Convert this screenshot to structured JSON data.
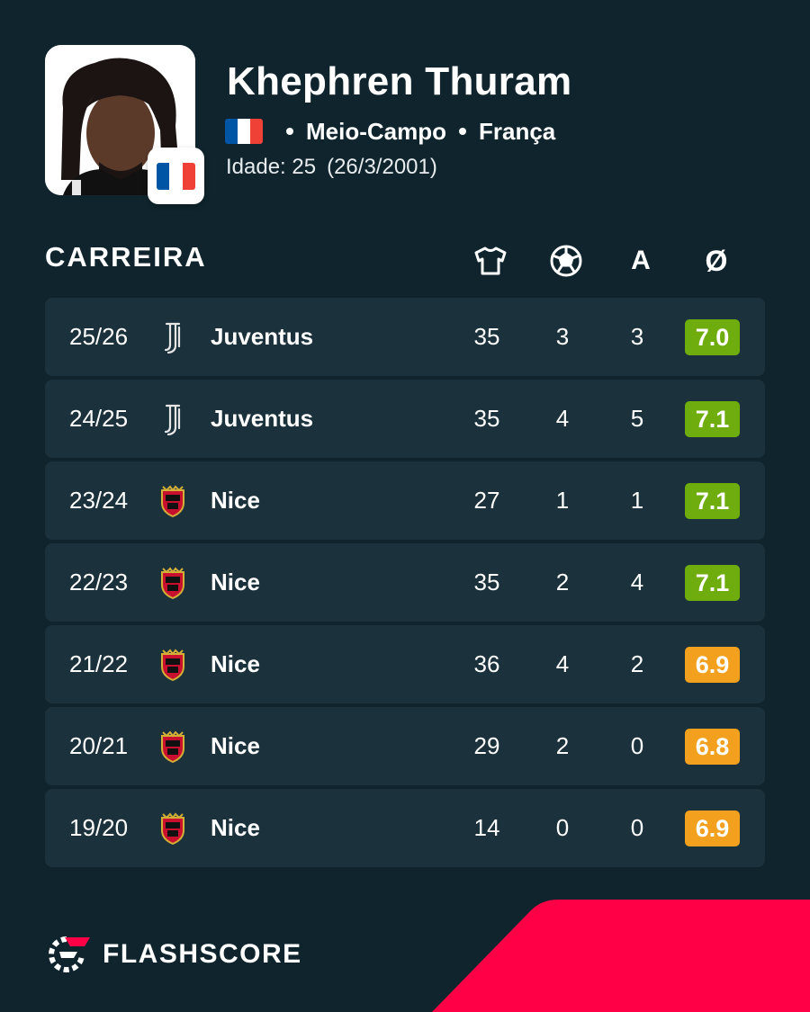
{
  "player": {
    "name": "Khephren Thuram",
    "position": "Meio-Campo",
    "country": "França",
    "age_text": "Idade: 25",
    "birthdate_text": "(26/3/2001)",
    "flag_colors": [
      "#0055a4",
      "#ffffff",
      "#ef4135"
    ]
  },
  "career": {
    "title": "CARREIRA",
    "columns": {
      "apps_icon": "jersey-icon",
      "goals_icon": "football-icon",
      "assists_label": "A",
      "average_label": "Ø"
    },
    "rows": [
      {
        "season": "25/26",
        "club": "Juventus",
        "club_icon": "juventus-logo-icon",
        "apps": "35",
        "goals": "3",
        "assists": "3",
        "rating": "7.0",
        "rating_color": "#6ead0d"
      },
      {
        "season": "24/25",
        "club": "Juventus",
        "club_icon": "juventus-logo-icon",
        "apps": "35",
        "goals": "4",
        "assists": "5",
        "rating": "7.1",
        "rating_color": "#6ead0d"
      },
      {
        "season": "23/24",
        "club": "Nice",
        "club_icon": "nice-crest-icon",
        "apps": "27",
        "goals": "1",
        "assists": "1",
        "rating": "7.1",
        "rating_color": "#6ead0d"
      },
      {
        "season": "22/23",
        "club": "Nice",
        "club_icon": "nice-crest-icon",
        "apps": "35",
        "goals": "2",
        "assists": "4",
        "rating": "7.1",
        "rating_color": "#6ead0d"
      },
      {
        "season": "21/22",
        "club": "Nice",
        "club_icon": "nice-crest-icon",
        "apps": "36",
        "goals": "4",
        "assists": "2",
        "rating": "6.9",
        "rating_color": "#f2a01e"
      },
      {
        "season": "20/21",
        "club": "Nice",
        "club_icon": "nice-crest-icon",
        "apps": "29",
        "goals": "2",
        "assists": "0",
        "rating": "6.8",
        "rating_color": "#f2a01e"
      },
      {
        "season": "19/20",
        "club": "Nice",
        "club_icon": "nice-crest-icon",
        "apps": "14",
        "goals": "0",
        "assists": "0",
        "rating": "6.9",
        "rating_color": "#f2a01e"
      }
    ]
  },
  "brand": {
    "name": "FLASHSCORE",
    "accent_color": "#ff0046"
  }
}
